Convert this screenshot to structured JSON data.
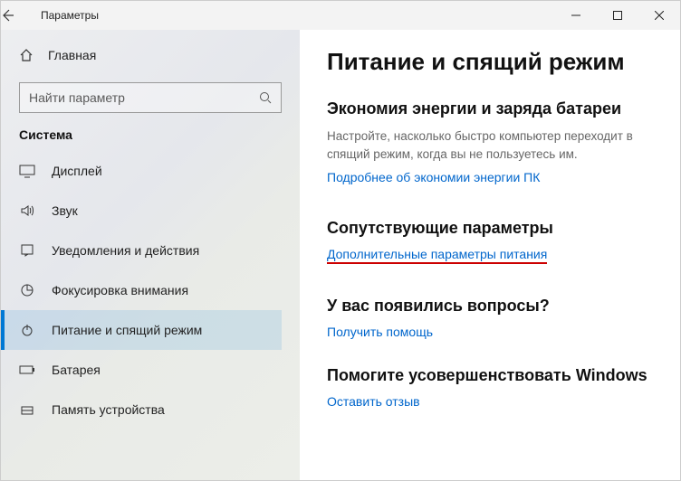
{
  "window": {
    "title": "Параметры"
  },
  "sidebar": {
    "home": "Главная",
    "search_placeholder": "Найти параметр",
    "group": "Система",
    "items": [
      {
        "label": "Дисплей"
      },
      {
        "label": "Звук"
      },
      {
        "label": "Уведомления и действия"
      },
      {
        "label": "Фокусировка внимания"
      },
      {
        "label": "Питание и спящий режим"
      },
      {
        "label": "Батарея"
      },
      {
        "label": "Память устройства"
      }
    ]
  },
  "main": {
    "title": "Питание и спящий режим",
    "energy": {
      "heading": "Экономия энергии и заряда батареи",
      "desc": "Настройте, насколько быстро компьютер переходит в спящий режим, когда вы не пользуетесь им.",
      "link": "Подробнее об экономии энергии ПК"
    },
    "related": {
      "heading": "Сопутствующие параметры",
      "link": "Дополнительные параметры питания"
    },
    "help": {
      "heading": "У вас появились вопросы?",
      "link": "Получить помощь"
    },
    "feedback": {
      "heading": "Помогите усовершенствовать Windows",
      "link": "Оставить отзыв"
    }
  }
}
